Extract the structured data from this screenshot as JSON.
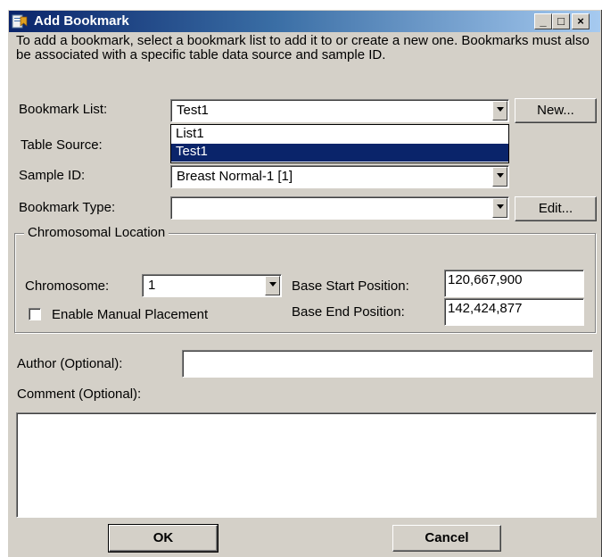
{
  "window": {
    "title": "Add Bookmark",
    "minimize_glyph": "_",
    "maximize_glyph": "□",
    "close_glyph": "×"
  },
  "intro": "To add a bookmark, select a bookmark list to add it to or create a new one. Bookmarks must also be associated with a specific table data source and sample ID.",
  "bookmark_list": {
    "label": "Bookmark List:",
    "value": "Test1",
    "new_button": "New...",
    "options": [
      "List1",
      "Test1"
    ],
    "selected_option": "Test1"
  },
  "table_source": {
    "label": "Table Source:"
  },
  "sample_id": {
    "label": "Sample ID:",
    "value": "Breast Normal-1 [1]"
  },
  "bookmark_type": {
    "label": "Bookmark Type:",
    "value": "",
    "edit_button": "Edit..."
  },
  "chromosomal_location": {
    "group_title": "Chromosomal Location",
    "chromosome_label": "Chromosome:",
    "chromosome_value": "1",
    "base_start_label": "Base Start Position:",
    "base_start_value": "120,667,900",
    "base_end_label": "Base End Position:",
    "base_end_value": "142,424,877",
    "manual_placement_label": "Enable Manual Placement",
    "manual_placement_checked": false
  },
  "author": {
    "label": "Author (Optional):",
    "value": ""
  },
  "comment": {
    "label": "Comment (Optional):",
    "value": ""
  },
  "buttons": {
    "ok": "OK",
    "cancel": "Cancel"
  },
  "icons": {
    "app": "bookmark-app-icon"
  },
  "colors": {
    "title_start": "#0a246a",
    "title_end": "#a6caf0",
    "face": "#d4d0c8",
    "selection": "#0a246a"
  }
}
